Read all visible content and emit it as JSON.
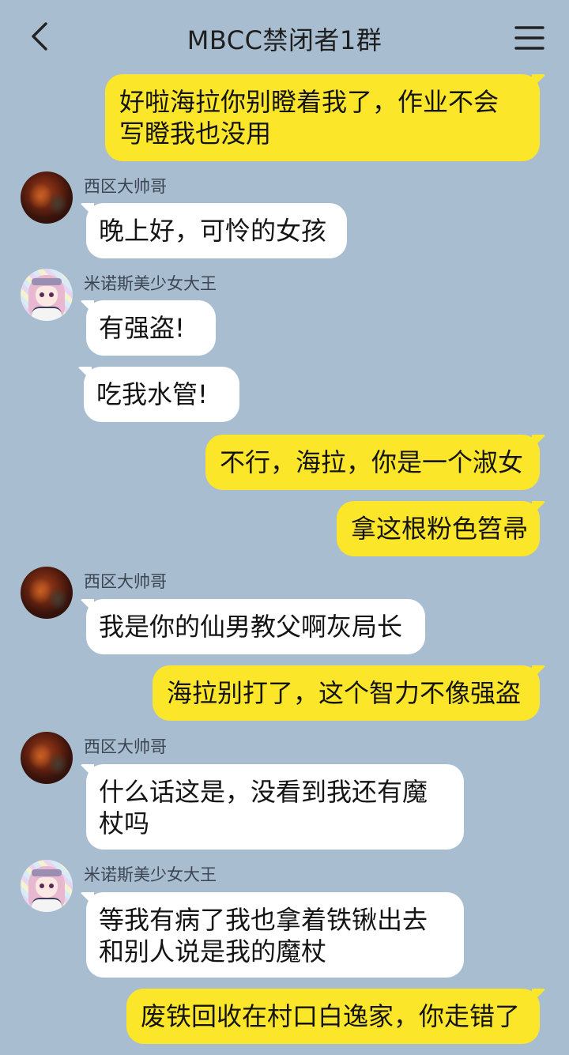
{
  "header": {
    "title": "MBCC禁闭者1群"
  },
  "icons": {
    "back": "chevron-left-icon",
    "menu": "hamburger-menu-icon"
  },
  "colors": {
    "background": "#a9bdd0",
    "outgoing_bubble": "#fce62a",
    "incoming_bubble": "#ffffff"
  },
  "senders": {
    "xiqu": "西区大帅哥",
    "minos": "米诺斯美少女大王"
  },
  "messages": {
    "m1": {
      "direction": "out",
      "lines": [
        "好啦海拉你别瞪着我了，作业不会",
        "写瞪我也没用"
      ]
    },
    "m2": {
      "direction": "in",
      "sender": "西区大帅哥",
      "lines": [
        "晚上好，可怜的女孩"
      ]
    },
    "m3": {
      "direction": "in",
      "sender": "米诺斯美少女大王",
      "lines": [
        "有强盗!"
      ]
    },
    "m4": {
      "direction": "in",
      "sender": "米诺斯美少女大王",
      "lines": [
        "吃我水管!"
      ]
    },
    "m5": {
      "direction": "out",
      "lines": [
        "不行，海拉，你是一个淑女"
      ]
    },
    "m6": {
      "direction": "out",
      "lines": [
        "拿这根粉色笤帚"
      ]
    },
    "m7": {
      "direction": "in",
      "sender": "西区大帅哥",
      "lines": [
        "我是你的仙男教父啊灰局长"
      ]
    },
    "m8": {
      "direction": "out",
      "lines": [
        "海拉别打了，这个智力不像强盗"
      ]
    },
    "m9": {
      "direction": "in",
      "sender": "西区大帅哥",
      "lines": [
        "什么话这是，没看到我还有魔",
        "杖吗"
      ]
    },
    "m10": {
      "direction": "in",
      "sender": "米诺斯美少女大王",
      "lines": [
        "等我有病了我也拿着铁锹出去",
        "和别人说是我的魔杖"
      ]
    },
    "m11": {
      "direction": "out",
      "lines": [
        "废铁回收在村口白逸家，你走错了"
      ]
    }
  }
}
